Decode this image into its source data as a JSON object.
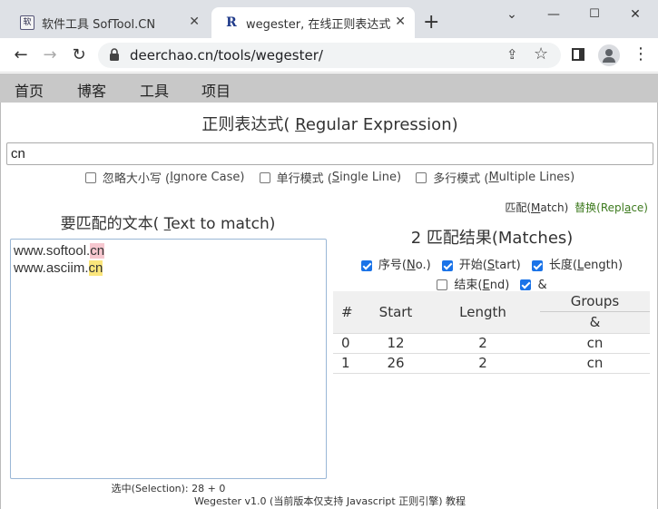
{
  "browser": {
    "tabs": [
      {
        "title": "软件工具 SofTool.CN",
        "favicon": "软"
      },
      {
        "title": "wegester, 在线正则表达式测试",
        "favicon": "R"
      }
    ],
    "url": "deerchao.cn/tools/wegester/"
  },
  "site_nav": [
    "首页",
    "博客",
    "工具",
    "项目"
  ],
  "regex": {
    "heading_prefix": "正则表达式( ",
    "heading_key": "R",
    "heading_suffix": "egular Expression)",
    "value": "cn",
    "options": [
      {
        "pre": "忽略大小写 ( ",
        "key": "I",
        "post": "gnore Case)",
        "checked": false
      },
      {
        "pre": "单行模式 ( ",
        "key": "S",
        "post": "ingle Line)",
        "checked": false
      },
      {
        "pre": "多行模式 ( ",
        "key": "M",
        "post": "ultiple Lines)",
        "checked": false
      }
    ]
  },
  "mode": {
    "match_pre": "匹配(",
    "match_key": "M",
    "match_post": "atch)",
    "replace_pre": "替换(Repl",
    "replace_key": "a",
    "replace_post": "ce)"
  },
  "text": {
    "heading_prefix": "要匹配的文本( ",
    "heading_key": "T",
    "heading_suffix": "ext to match)",
    "lines": [
      {
        "plain": "www.softool.",
        "match": "cn"
      },
      {
        "plain": "www.asciim.",
        "match": "cn"
      }
    ],
    "selection": "选中(Selection): 28 + 0"
  },
  "results": {
    "heading": "2 匹配结果(Matches)",
    "columns": [
      {
        "pre": "序号( ",
        "key": "N",
        "post": "o.)",
        "checked": true
      },
      {
        "pre": "开始(",
        "key": "S",
        "post": "tart)",
        "checked": true
      },
      {
        "pre": "长度( ",
        "key": "L",
        "post": "ength)",
        "checked": true
      },
      {
        "pre": "结束( ",
        "key": "E",
        "post": "nd)",
        "checked": false
      },
      {
        "pre": "&",
        "key": "",
        "post": "",
        "checked": true
      }
    ],
    "table_headers": {
      "no": "#",
      "start": "Start",
      "length": "Length",
      "groups": "Groups",
      "group0": "&"
    },
    "rows": [
      {
        "no": "0",
        "start": "12",
        "length": "2",
        "group0": "cn"
      },
      {
        "no": "1",
        "start": "26",
        "length": "2",
        "group0": "cn"
      }
    ]
  },
  "footer": {
    "pre": "Wegester v1.0 (当前版本仅支持 Javascript 正则引擎) ",
    "link": "教程"
  }
}
